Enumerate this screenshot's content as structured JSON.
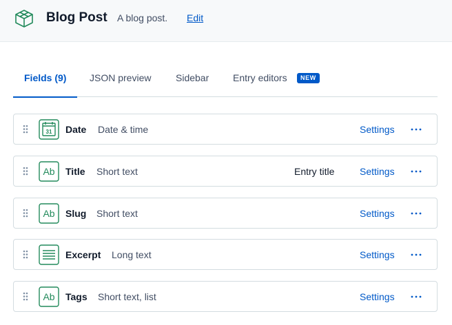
{
  "header": {
    "title": "Blog Post",
    "description": "A blog post.",
    "edit_label": "Edit",
    "icon": "content-type-box-icon"
  },
  "tabs": [
    {
      "label": "Fields (9)",
      "active": true
    },
    {
      "label": "JSON preview",
      "active": false
    },
    {
      "label": "Sidebar",
      "active": false
    },
    {
      "label": "Entry editors",
      "active": false,
      "badge": "NEW"
    }
  ],
  "fields": [
    {
      "name": "Date",
      "type": "Date & time",
      "icon": "calendar-icon",
      "entry_title": "",
      "settings_label": "Settings"
    },
    {
      "name": "Title",
      "type": "Short text",
      "icon": "short-text-icon",
      "entry_title": "Entry title",
      "settings_label": "Settings"
    },
    {
      "name": "Slug",
      "type": "Short text",
      "icon": "short-text-icon",
      "entry_title": "",
      "settings_label": "Settings"
    },
    {
      "name": "Excerpt",
      "type": "Long text",
      "icon": "long-text-icon",
      "entry_title": "",
      "settings_label": "Settings"
    },
    {
      "name": "Tags",
      "type": "Short text, list",
      "icon": "short-text-icon",
      "entry_title": "",
      "settings_label": "Settings"
    }
  ],
  "colors": {
    "accent": "#0059c8",
    "icon_green": "#228a5b",
    "text": "#111b2b",
    "muted": "#414d63",
    "border": "#d3dce0"
  }
}
